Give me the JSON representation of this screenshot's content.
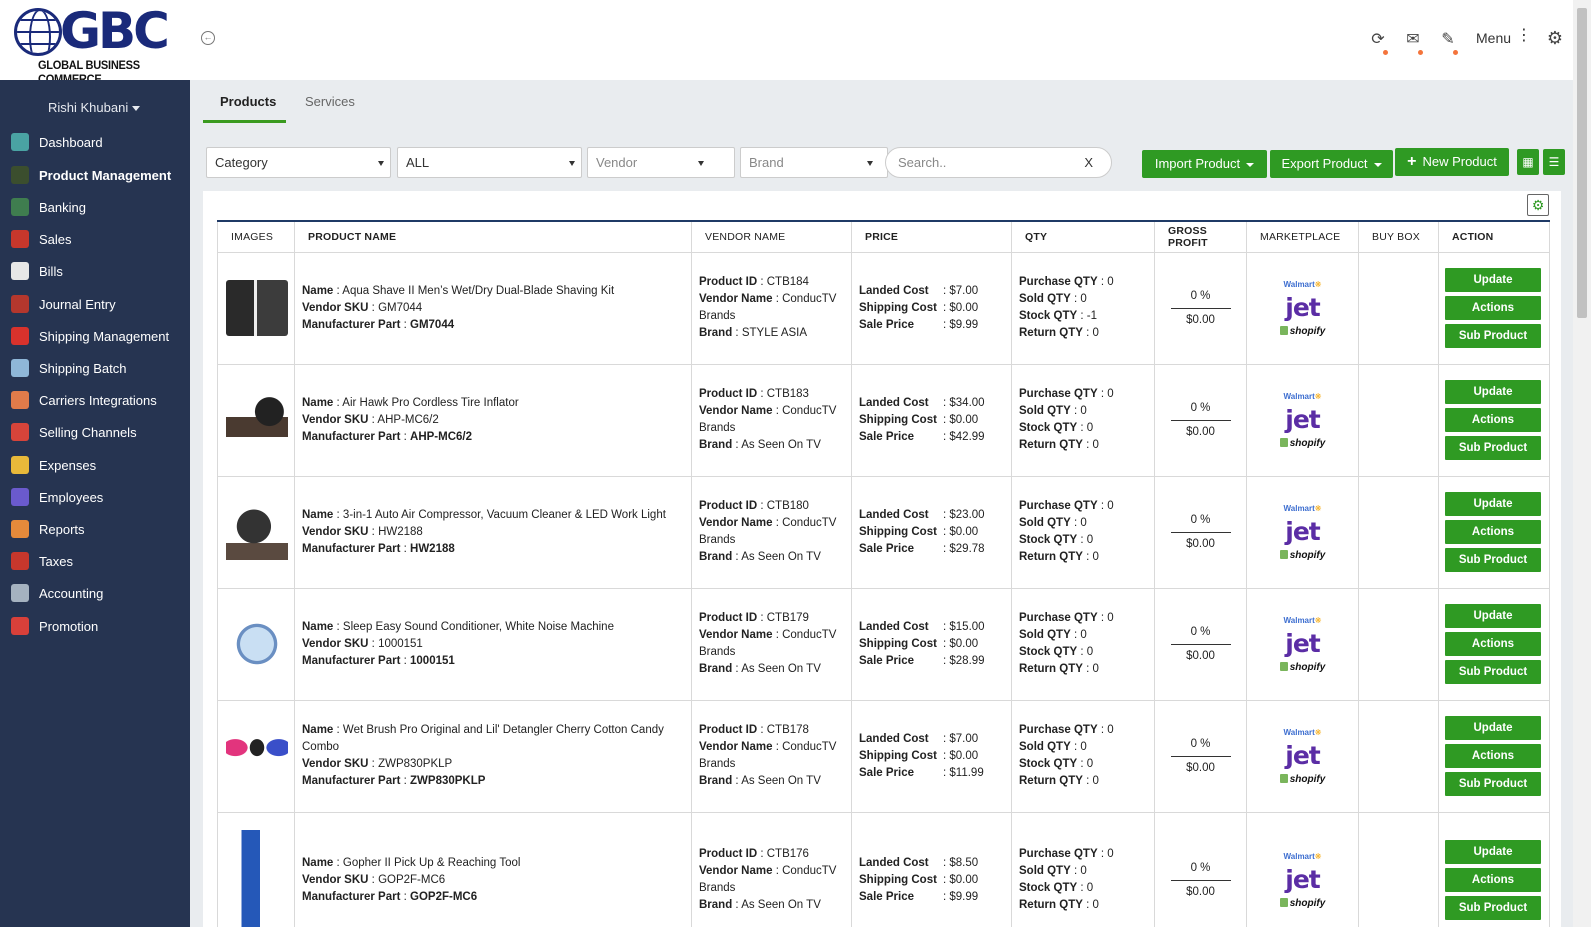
{
  "brand": {
    "logo_text": "GBC",
    "logo_sub": "GLOBAL BUSINESS COMMERCE"
  },
  "header": {
    "menu_label": "Menu"
  },
  "sidebar": {
    "user": "Rishi Khubani",
    "items": [
      {
        "label": "Dashboard",
        "icon": "dashboard-icon",
        "color": "#4aa3a3"
      },
      {
        "label": "Product Management",
        "icon": "product-icon",
        "color": "#3b4e2e"
      },
      {
        "label": "Banking",
        "icon": "bank-icon",
        "color": "#3f7d4f"
      },
      {
        "label": "Sales",
        "icon": "sales-icon",
        "color": "#c7372c"
      },
      {
        "label": "Bills",
        "icon": "bills-icon",
        "color": "#e7e7e7"
      },
      {
        "label": "Journal Entry",
        "icon": "journal-icon",
        "color": "#b4372d"
      },
      {
        "label": "Shipping Management",
        "icon": "truck-icon",
        "color": "#d8322c"
      },
      {
        "label": "Shipping Batch",
        "icon": "batch-icon",
        "color": "#8fb7d8"
      },
      {
        "label": "Carriers Integrations",
        "icon": "carrier-icon",
        "color": "#e07b4a"
      },
      {
        "label": "Selling Channels",
        "icon": "channels-icon",
        "color": "#d6443a"
      },
      {
        "label": "Expenses",
        "icon": "expenses-icon",
        "color": "#e8b93a"
      },
      {
        "label": "Employees",
        "icon": "employees-icon",
        "color": "#6a5acd"
      },
      {
        "label": "Reports",
        "icon": "reports-icon",
        "color": "#e58a3b"
      },
      {
        "label": "Taxes",
        "icon": "taxes-icon",
        "color": "#c7372c"
      },
      {
        "label": "Accounting",
        "icon": "accounting-icon",
        "color": "#a5b2c0"
      },
      {
        "label": "Promotion",
        "icon": "promotion-icon",
        "color": "#d8403a"
      }
    ]
  },
  "tabs": [
    {
      "label": "Products"
    },
    {
      "label": "Services"
    }
  ],
  "filters": {
    "category": "Category",
    "all": "ALL",
    "vendor": "Vendor",
    "brand": "Brand",
    "search_placeholder": "Search..",
    "search_clear": "X"
  },
  "toolbar": {
    "import_label": "Import Product",
    "export_label": "Export Product",
    "new_label": "New Product"
  },
  "table": {
    "headers": [
      "IMAGES",
      "PRODUCT NAME",
      "VENDOR NAME",
      "PRICE",
      "QTY",
      "GROSS PROFIT",
      "MARKETPLACE",
      "BUY BOX",
      "ACTION"
    ],
    "field_labels": {
      "name": "Name",
      "vendor_sku": "Vendor SKU",
      "mfr_part": "Manufacturer Part",
      "product_id": "Product ID",
      "vendor_name": "Vendor Name",
      "brand": "Brand",
      "landed": "Landed Cost",
      "shipping": "Shipping Cost",
      "sale": "Sale Price",
      "purchase_qty": "Purchase QTY",
      "sold_qty": "Sold QTY",
      "stock_qty": "Stock QTY",
      "return_qty": "Return QTY"
    },
    "marketplaces": {
      "walmart": "Walmart",
      "jet": "jet",
      "shopify": "shopify"
    },
    "actions": {
      "update": "Update",
      "actions": "Actions",
      "sub_product": "Sub Product"
    },
    "rows": [
      {
        "name": "Aqua Shave II Men’s Wet/Dry Dual-Blade Shaving Kit",
        "sku": "GM7044",
        "mfr": "GM7044",
        "pid": "CTB184",
        "vendor": "ConducTV Brands",
        "brand": "STYLE ASIA",
        "landed": "$7.00",
        "shipping": "$0.00",
        "sale": "$9.99",
        "purchase": "0",
        "sold": "0",
        "stock": "-1",
        "ret": "0",
        "gp_pct": "0 %",
        "gp_amt": "$0.00"
      },
      {
        "name": "Air Hawk Pro Cordless Tire Inflator",
        "sku": "AHP-MC6/2",
        "mfr": "AHP-MC6/2",
        "pid": "CTB183",
        "vendor": "ConducTV Brands",
        "brand": "As Seen On TV",
        "landed": "$34.00",
        "shipping": "$0.00",
        "sale": "$42.99",
        "purchase": "0",
        "sold": "0",
        "stock": "0",
        "ret": "0",
        "gp_pct": "0 %",
        "gp_amt": "$0.00"
      },
      {
        "name": "3-in-1 Auto Air Compressor, Vacuum Cleaner & LED Work Light",
        "sku": "HW2188",
        "mfr": "HW2188",
        "pid": "CTB180",
        "vendor": "ConducTV Brands",
        "brand": "As Seen On TV",
        "landed": "$23.00",
        "shipping": "$0.00",
        "sale": "$29.78",
        "purchase": "0",
        "sold": "0",
        "stock": "0",
        "ret": "0",
        "gp_pct": "0 %",
        "gp_amt": "$0.00"
      },
      {
        "name": "Sleep Easy Sound Conditioner, White Noise Machine",
        "sku": "1000151",
        "mfr": "1000151",
        "pid": "CTB179",
        "vendor": "ConducTV Brands",
        "brand": "As Seen On TV",
        "landed": "$15.00",
        "shipping": "$0.00",
        "sale": "$28.99",
        "purchase": "0",
        "sold": "0",
        "stock": "0",
        "ret": "0",
        "gp_pct": "0 %",
        "gp_amt": "$0.00"
      },
      {
        "name": "Wet Brush Pro Original and Lil' Detangler Cherry Cotton Candy Combo",
        "sku": "ZWP830PKLP",
        "mfr": "ZWP830PKLP",
        "pid": "CTB178",
        "vendor": "ConducTV Brands",
        "brand": "As Seen On TV",
        "landed": "$7.00",
        "shipping": "$0.00",
        "sale": "$11.99",
        "purchase": "0",
        "sold": "0",
        "stock": "0",
        "ret": "0",
        "gp_pct": "0 %",
        "gp_amt": "$0.00"
      },
      {
        "name": "Gopher II Pick Up & Reaching Tool",
        "sku": "GOP2F-MC6",
        "mfr": "GOP2F-MC6",
        "pid": "CTB176",
        "vendor": "ConducTV Brands",
        "brand": "As Seen On TV",
        "landed": "$8.50",
        "shipping": "$0.00",
        "sale": "$9.99",
        "purchase": "0",
        "sold": "0",
        "stock": "0",
        "ret": "0",
        "gp_pct": "0 %",
        "gp_amt": "$0.00"
      }
    ]
  }
}
